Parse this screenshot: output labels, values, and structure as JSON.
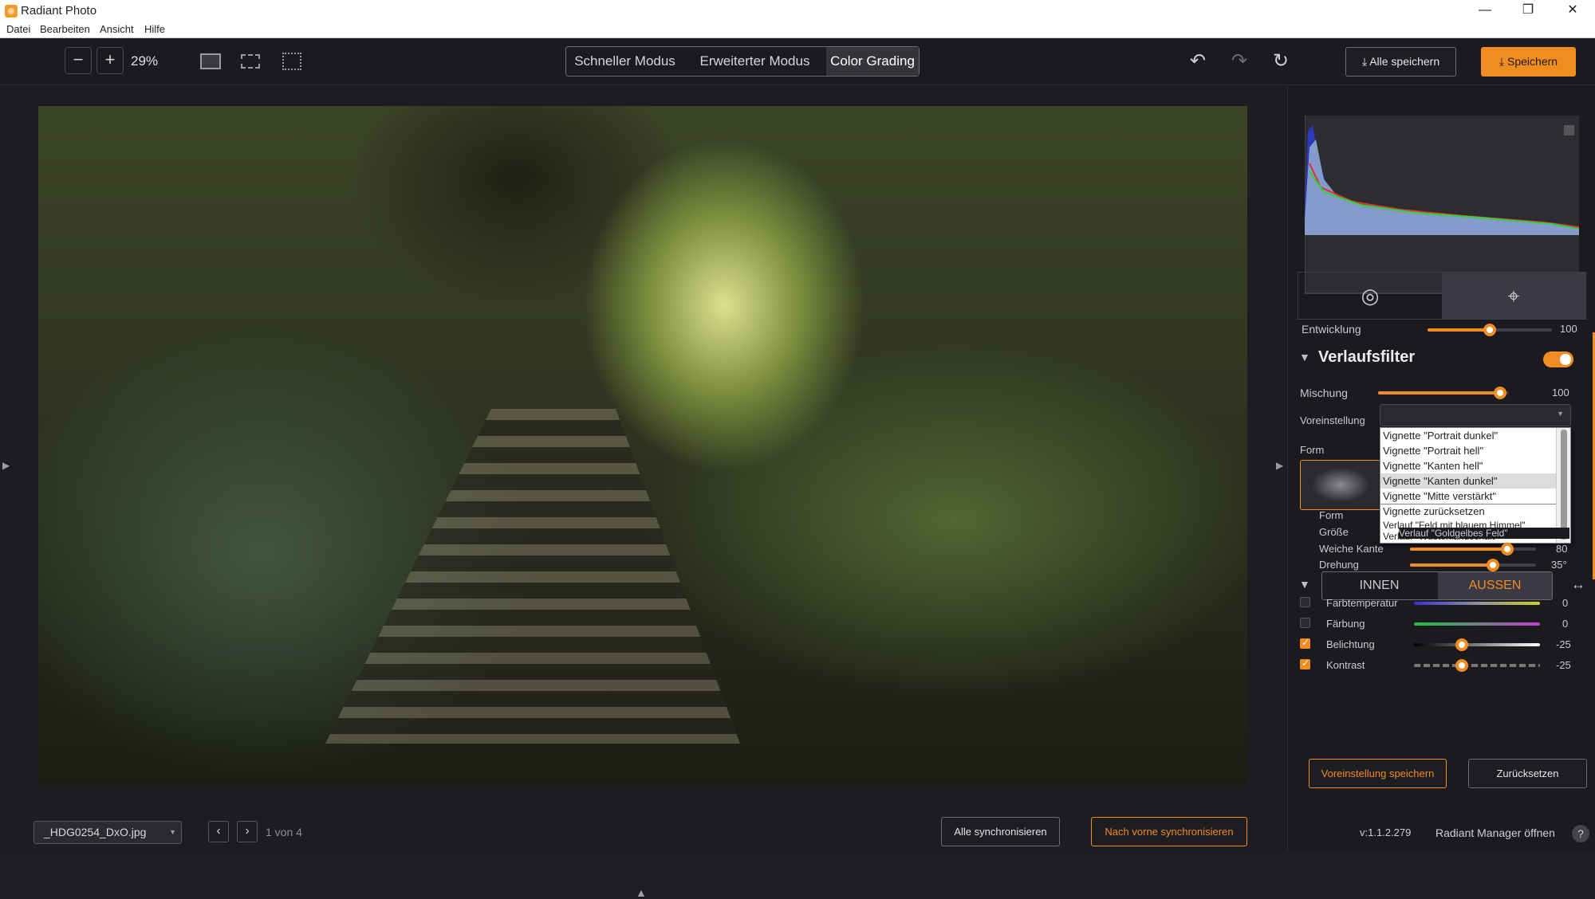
{
  "app": {
    "title": "Radiant Photo"
  },
  "window": {
    "minimize": "—",
    "restore": "❐",
    "close": "✕"
  },
  "menu": [
    "Datei",
    "Bearbeiten",
    "Ansicht",
    "Hilfe"
  ],
  "toolbar": {
    "zoom_out": "−",
    "zoom_in": "+",
    "zoom_level": "29%",
    "modes": [
      "Schneller Modus",
      "Erweiterter Modus",
      "Color Grading"
    ],
    "active_mode": "Color Grading",
    "undo": "↶",
    "redo": "↷",
    "reset": "↻",
    "save_all": "Alle speichern",
    "save": "Speichern",
    "download_icon": "⤓"
  },
  "canvas": {
    "left_arrow": "▶",
    "right_arrow": "▶",
    "up_arrow": "▲",
    "play": "❚▶"
  },
  "bottom": {
    "file_name": "_HDG0254_DxO.jpg",
    "dropdown_arrow": "▼",
    "prev": "‹",
    "next": "›",
    "count": "1 von 4",
    "sync_all": "Alle synchronisieren",
    "sync_forward": "Nach vorne synchronisieren"
  },
  "panel": {
    "development": {
      "label": "Entwicklung",
      "value": "100",
      "level": 0.5
    },
    "tabs": [
      "◎",
      "⌖"
    ],
    "section": "Verlaufsfilter",
    "mix": {
      "label": "Mischung",
      "value": "100",
      "level": 0.93
    },
    "preset": {
      "label": "Voreinstellung"
    },
    "shape_label": "Form",
    "dropdown_items": [
      "Vignette \"Portrait dunkel\"",
      "Vignette \"Portrait hell\"",
      "Vignette \"Kanten hell\"",
      "Vignette \"Kanten dunkel\"",
      "Vignette \"Mitte verstärkt\"",
      "Vignette zurücksetzen",
      "Verlauf \"Feld mit blauem Himmel\"",
      "Verlauf \"Wüstenlandschaft\"",
      "Verlauf \"Goldgelbes Feld\""
    ],
    "sub": {
      "form": {
        "label": "Form"
      },
      "size": {
        "label": "Größe"
      },
      "feather": {
        "label": "Weiche Kante",
        "value": "80",
        "level": 0.77
      },
      "rotation": {
        "label": "Drehung",
        "value": "35°",
        "level": 0.66
      }
    },
    "inside": "INNEN",
    "outside": "AUSSEN",
    "swap_icon": "↔",
    "adjust": [
      {
        "label": "Farbtemperatur",
        "value": "0",
        "checked": false
      },
      {
        "label": "Färbung",
        "value": "0",
        "checked": false
      },
      {
        "label": "Belichtung",
        "value": "-25",
        "checked": true,
        "level": 0.38
      },
      {
        "label": "Kontrast",
        "value": "-25",
        "checked": true,
        "level": 0.38
      }
    ],
    "save_preset": "Voreinstellung speichern",
    "reset": "Zurücksetzen",
    "version": "v:1.1.2.279",
    "manager": "Radiant Manager öffnen",
    "help": "?"
  },
  "colors": {
    "accent": "#f08c22",
    "background": "#1a1a1f",
    "panel_active": "#3a3a42"
  }
}
